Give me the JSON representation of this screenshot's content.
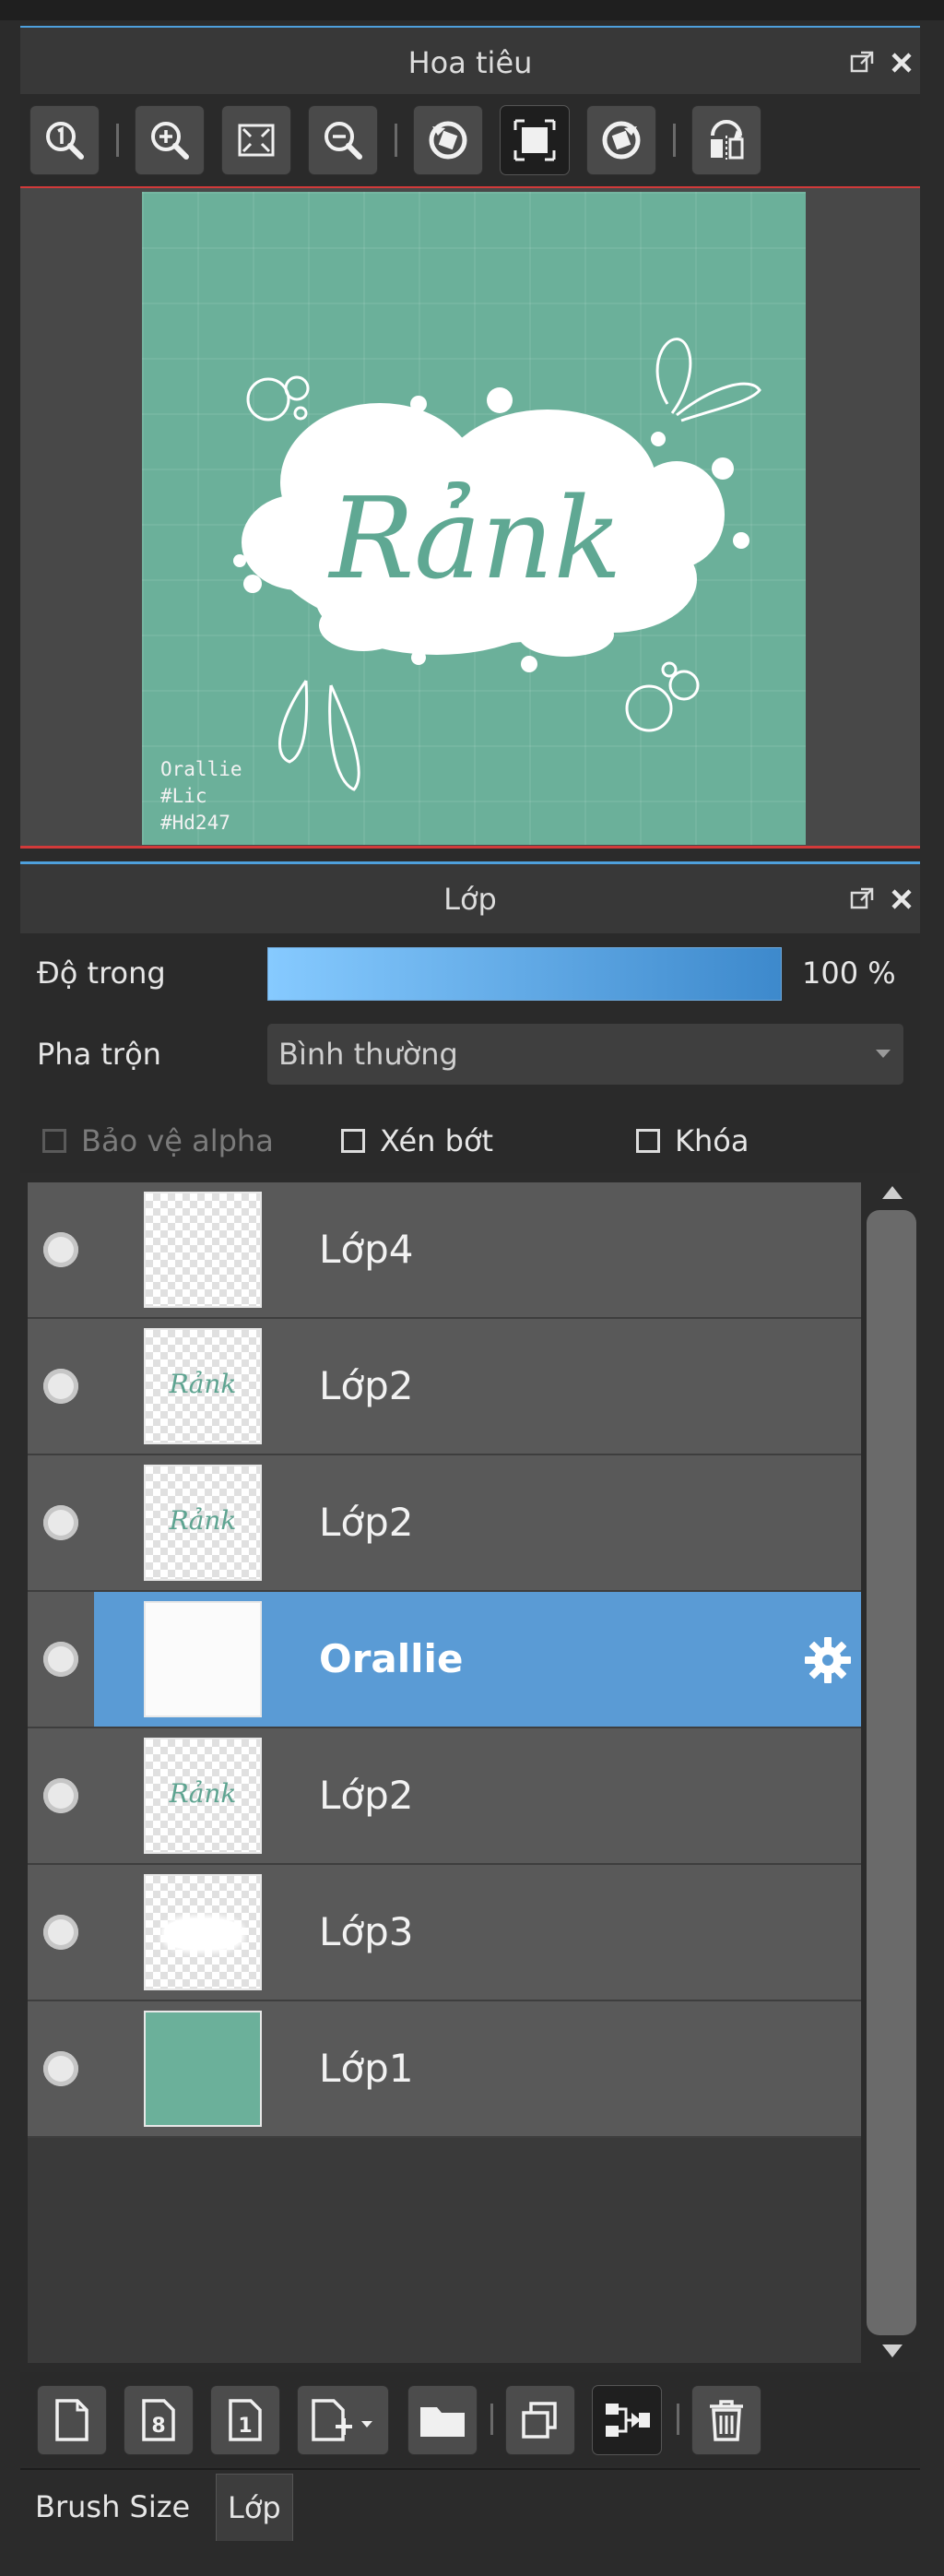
{
  "navigator": {
    "title": "Hoa tiêu",
    "toolbar": [
      {
        "name": "zoom-actual-icon"
      },
      {
        "name": "zoom-in-icon"
      },
      {
        "name": "fit-screen-icon"
      },
      {
        "name": "zoom-out-icon"
      },
      {
        "name": "rotate-left-icon"
      },
      {
        "name": "reset-view-icon",
        "selected": true
      },
      {
        "name": "rotate-right-icon"
      },
      {
        "name": "flip-horizontal-icon"
      }
    ],
    "canvas": {
      "artwork_text": "Rảnk",
      "hashtags": [
        "Orallie",
        "#Lic",
        "#Hd247"
      ],
      "bg_color": "#6bb09a"
    }
  },
  "layer_panel": {
    "title": "Lớp",
    "opacity_label": "Độ trong",
    "opacity_value": "100 %",
    "opacity_percent": 100,
    "blend_label": "Pha trộn",
    "blend_value": "Bình thường",
    "protect_alpha": "Bảo vệ alpha",
    "clipping": "Xén bớt",
    "lock": "Khóa",
    "layers": [
      {
        "name": "Lớp4",
        "thumb": "empty"
      },
      {
        "name": "Lớp2",
        "thumb": "text"
      },
      {
        "name": "Lớp2",
        "thumb": "text"
      },
      {
        "name": "Orallie",
        "thumb": "white",
        "selected": true
      },
      {
        "name": "Lớp2",
        "thumb": "text"
      },
      {
        "name": "Lớp3",
        "thumb": "blob"
      },
      {
        "name": "Lớp1",
        "thumb": "solid"
      }
    ],
    "thumb_text": "Rảnk",
    "toolbar": [
      {
        "name": "new-layer-icon"
      },
      {
        "name": "new-8bit-layer-icon"
      },
      {
        "name": "new-1bit-layer-icon"
      },
      {
        "name": "add-layer-menu-icon"
      },
      {
        "name": "folder-icon"
      },
      {
        "name": "duplicate-layer-icon"
      },
      {
        "name": "merge-layer-icon"
      },
      {
        "name": "trash-icon"
      }
    ]
  },
  "bottom_tabs": [
    {
      "label": "Brush Size",
      "active": false
    },
    {
      "label": "Lớp",
      "active": true
    }
  ],
  "colors": {
    "accent_blue": "#5a9bd5",
    "separator_blue": "#4ea0dc",
    "separator_red": "#d23a3a",
    "canvas_green": "#6bb09a"
  }
}
